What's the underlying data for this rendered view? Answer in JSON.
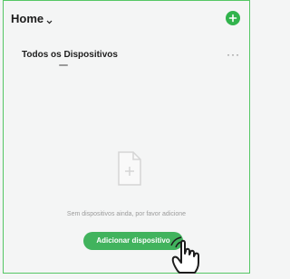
{
  "header": {
    "home_label": "Home",
    "accent_color": "#31b34c"
  },
  "tabs": {
    "active_label": "Todos os Dispositivos"
  },
  "empty_state": {
    "message": "Sem dispositivos ainda, por favor adicione",
    "add_button_label": "Adicionar dispositivo"
  },
  "icons": {
    "home_dropdown": "chevron-down-icon",
    "add": "plus-icon",
    "more": "more-icon",
    "empty": "empty-document-icon",
    "pointer": "pointer-hand-icon"
  }
}
